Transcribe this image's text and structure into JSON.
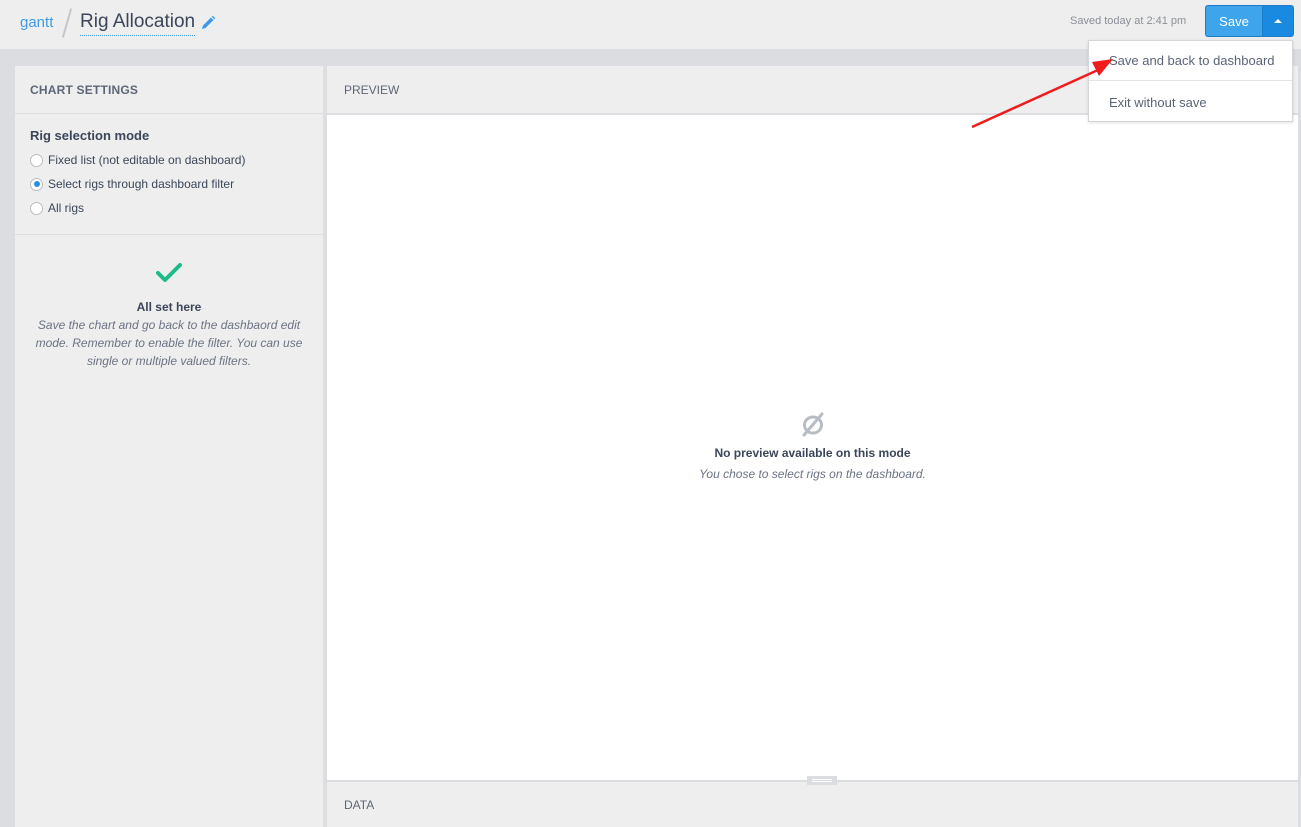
{
  "header": {
    "breadcrumb_link": "gantt",
    "title": "Rig Allocation",
    "saved_status": "Saved today at 2:41 pm",
    "save_label": "Save",
    "dropdown": {
      "items": [
        {
          "label": "Save and back to dashboard"
        },
        {
          "label": "Exit without save"
        }
      ]
    }
  },
  "settings": {
    "header": "CHART SETTINGS",
    "rig_selection": {
      "label": "Rig selection mode",
      "options": [
        {
          "label": "Fixed list (not editable on dashboard)",
          "checked": false
        },
        {
          "label": "Select rigs through dashboard filter",
          "checked": true
        },
        {
          "label": "All rigs",
          "checked": false
        }
      ]
    },
    "status": {
      "icon": "check-icon",
      "title": "All set here",
      "text": "Save the chart and go back to the dashbaord edit mode. Remember to enable the filter. You can use single or multiple valued filters."
    }
  },
  "preview": {
    "header": "PREVIEW",
    "empty_icon": "empty-set-icon",
    "empty_title": "No preview available on this mode",
    "empty_subtitle": "You chose to select rigs on the dashboard."
  },
  "data_section": {
    "header": "DATA"
  },
  "colors": {
    "accent": "#3ea5ec",
    "accent_dark": "#1a8ae0",
    "success": "#1fba8a",
    "annotation": "#ee1c1c"
  }
}
